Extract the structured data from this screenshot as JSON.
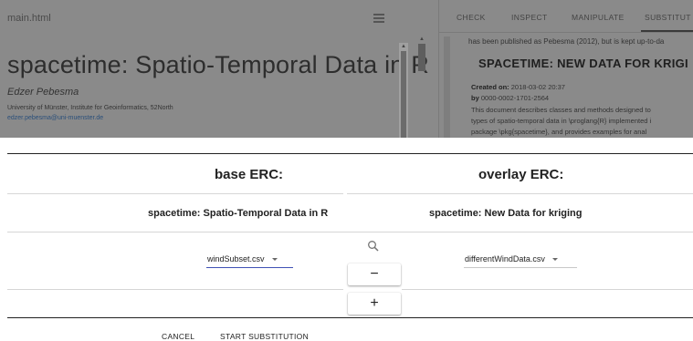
{
  "background": {
    "file_name": "main.html",
    "doc_title": "spacetime: Spatio-Temporal Data in R",
    "doc_author": "Edzer Pebesma",
    "doc_affiliation": "University of Münster, Institute for Geoinformatics, 52North",
    "doc_email": "edzer.pebesma@uni-muenster.de",
    "tabs": [
      "CHECK",
      "INSPECT",
      "MANIPULATE",
      "SUBSTITUT"
    ],
    "preview": {
      "published_note": "has been published as Pebesma (2012), but is kept up-to-da",
      "title": "SPACETIME: NEW DATA FOR KRIGI",
      "created_label": "Created on:",
      "created_value": "2018-03-02 20:37",
      "by_label": "by",
      "by_value": "0000-0002-1701-2564",
      "desc_line1": "This document describes classes and methods designed to",
      "desc_line2": "types of spatio-temporal data in \\proglang{R} implemented i",
      "desc_line3": "package \\pkg{spacetime}, and provides examples for anal"
    }
  },
  "substitution": {
    "base_header": "base ERC:",
    "overlay_header": "overlay ERC:",
    "base_title": "spacetime: Spatio-Temporal Data in R",
    "overlay_title": "spacetime: New Data for kriging",
    "base_file": "windSubset.csv",
    "overlay_file": "differentWindData.csv",
    "remove_label": "−",
    "add_label": "+",
    "cancel_label": "CANCEL",
    "start_label": "START SUBSTITUTION"
  },
  "colors": {
    "overlay": "#8a8a8a",
    "accent_underline": "#3f51b5"
  }
}
